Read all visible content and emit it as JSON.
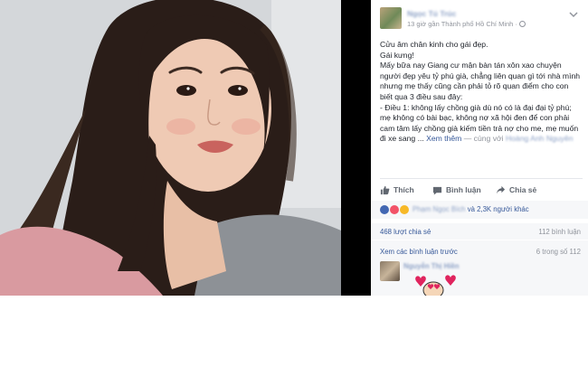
{
  "colors": {
    "fb_blue": "#365899",
    "text": "#1d2129",
    "muted": "#90949c",
    "panel_bg": "#ffffff",
    "bar_bg": "#f6f7f9",
    "backdrop": "#000000"
  },
  "photo": {
    "alt_kind": "selfie-photo"
  },
  "post": {
    "author": "Ngọc Tú Trúc",
    "meta": "13 giờ gần Thành phố Hồ Chí Minh · ",
    "menu_icon": "chevron-down-icon",
    "text_lines": {
      "l1": "Cửu âm chân kinh cho gái đẹp.",
      "l2": "Gái kưng!",
      "l3": "Mấy bữa nay Giang cư mận bàn tán xôn xao chuyện người đẹp yêu tỷ phú già, chẳng liên quan gì tới nhà mình nhưng mẹ thấy cũng cần phải tỏ rõ quan điểm cho con biết qua 3 điều sau đây:",
      "l4": "- Điều 1: không lấy chồng già dù nó có là đại đại tỷ phú; mẹ không có bài bạc, không nợ xã hội đen để con phải cam tâm lấy chồng già kiếm tiền trả nợ cho me, mẹ muốn đi xe sang ...",
      "see_more": "Xem thêm",
      "with": "— cùng với",
      "tagged": "Hoàng Anh Nguyên"
    }
  },
  "actions": {
    "like": "Thích",
    "comment": "Bình luận",
    "share": "Chia sẻ"
  },
  "reactions": {
    "names_blurred": "Phạm Ngọc Bích",
    "suffix": "và 2,3K người khác"
  },
  "stats": {
    "shares": "468 lượt chia sẻ",
    "comments": "112 bình luận"
  },
  "comments": {
    "view_previous": "Xem các bình luận trước",
    "pager": "6 trong số 112",
    "first_commenter": "Nguyễn Thị Hiền"
  }
}
